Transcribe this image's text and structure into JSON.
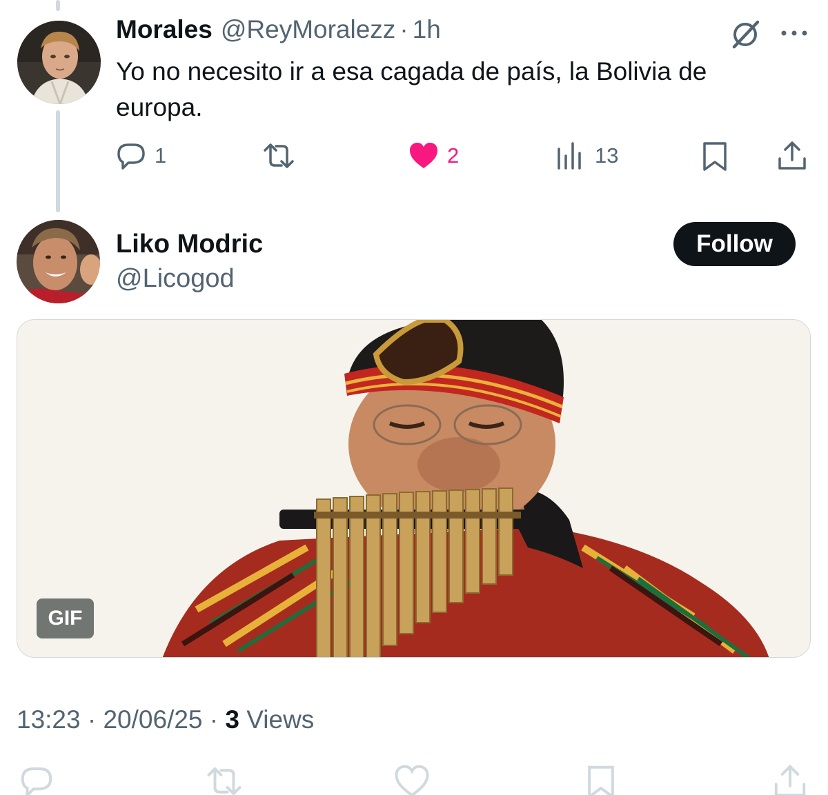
{
  "reply": {
    "name": "Morales",
    "handle": "@ReyMoralezz",
    "separator": "·",
    "time": "1h",
    "text": "Yo no necesito ir a esa cagada de país, la Bolivia de europa.",
    "actions": {
      "replies": "1",
      "likes": "2",
      "views": "13"
    },
    "icons": [
      "grok-icon",
      "more-icon",
      "reply-icon",
      "retweet-icon",
      "heart-icon",
      "views-icon",
      "bookmark-icon",
      "share-icon"
    ]
  },
  "main": {
    "author_name": "Liko Modric",
    "author_handle": "@Licogod",
    "follow_label": "Follow",
    "media_badge": "GIF",
    "meta": {
      "time": "13:23",
      "sep1": "·",
      "date": "20/06/25",
      "sep2": "·",
      "views_count": "3",
      "views_label": "Views"
    }
  },
  "colors": {
    "text": "#0f1419",
    "secondary": "#536471",
    "like": "#f91880",
    "thread_line": "#cfd9de",
    "follow_bg": "#0f1419"
  }
}
